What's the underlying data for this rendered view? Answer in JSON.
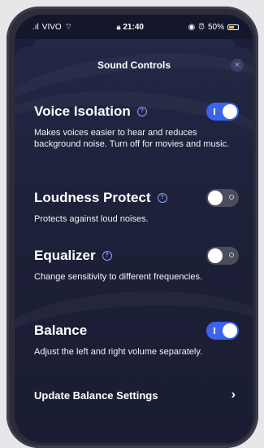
{
  "status_bar": {
    "carrier": "VIVO",
    "time": "21:40",
    "battery": "50%"
  },
  "sheet": {
    "title": "Sound Controls",
    "close_label": "×"
  },
  "settings": [
    {
      "title": "Voice Isolation",
      "description": "Makes voices easier to hear and reduces background noise. Turn off for movies and music.",
      "enabled": true
    },
    {
      "title": "Loudness Protect",
      "description": "Protects against loud noises.",
      "enabled": false
    },
    {
      "title": "Equalizer",
      "description": "Change sensitivity to different frequencies.",
      "enabled": false
    },
    {
      "title": "Balance",
      "description": "Adjust the left and right volume separately.",
      "enabled": true
    }
  ],
  "link": {
    "label": "Update Balance Settings",
    "chevron": "›"
  },
  "colors": {
    "accent": "#3a63f0",
    "background": "#1b1f3a"
  }
}
